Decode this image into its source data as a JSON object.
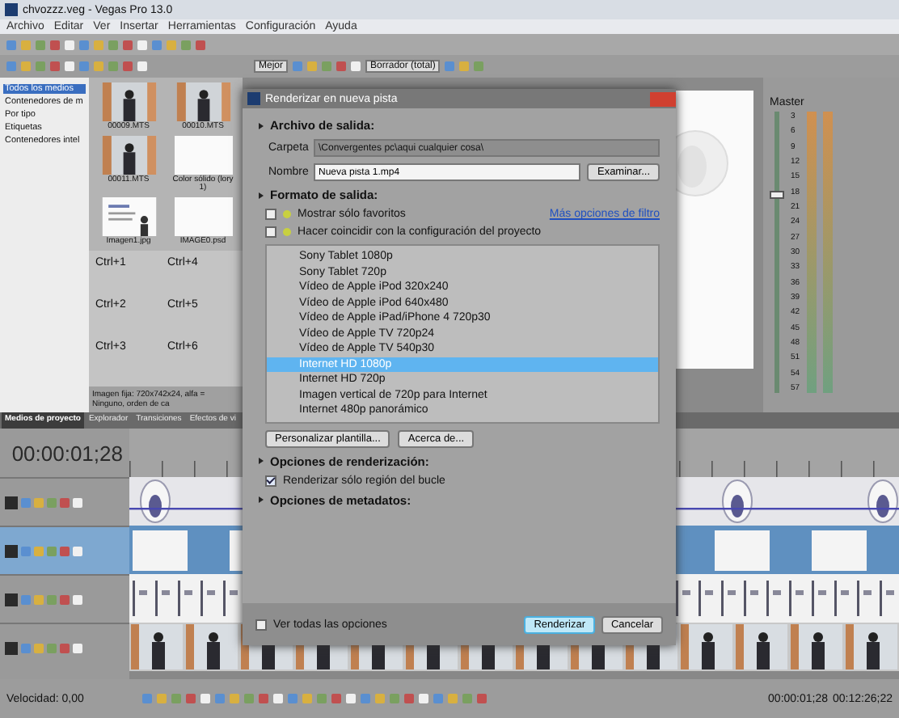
{
  "window": {
    "title": "chvozzz.veg - Vegas Pro 13.0"
  },
  "menu": [
    "Archivo",
    "Editar",
    "Ver",
    "Insertar",
    "Herramientas",
    "Configuración",
    "Ayuda"
  ],
  "toolbar": {
    "zoom_label": "Mejor",
    "format_label": "Borrador (total)"
  },
  "media_tree": [
    {
      "label": "Todos los medios",
      "selected": true
    },
    {
      "label": "Contenedores de m",
      "selected": false
    },
    {
      "label": "Por tipo",
      "selected": false
    },
    {
      "label": "Etiquetas",
      "selected": false
    },
    {
      "label": "Contenedores intel",
      "selected": false
    }
  ],
  "media_items": [
    {
      "name": "00009.MTS",
      "kind": "video"
    },
    {
      "name": "00010.MTS",
      "kind": "video"
    },
    {
      "name": "00011.MTS",
      "kind": "video"
    },
    {
      "name": "Color sólido (lory 1)",
      "kind": "blank"
    },
    {
      "name": "Imagen1.jpg",
      "kind": "slide"
    },
    {
      "name": "IMAGE0.psd",
      "kind": "blank"
    }
  ],
  "shortcuts": [
    "Ctrl+1",
    "Ctrl+4",
    "Ctrl+2",
    "Ctrl+5",
    "Ctrl+3",
    "Ctrl+6"
  ],
  "media_status": "Imagen fija: 720x742x24, alfa = Ninguno, orden de ca",
  "panel_tabs": [
    {
      "label": "Medios de proyecto",
      "selected": true
    },
    {
      "label": "Explorador",
      "selected": false
    },
    {
      "label": "Transiciones",
      "selected": false
    },
    {
      "label": "Efectos de vi",
      "selected": false
    }
  ],
  "meter": {
    "title": "Master",
    "scale": [
      "3",
      "6",
      "9",
      "12",
      "15",
      "18",
      "21",
      "24",
      "27",
      "30",
      "33",
      "36",
      "39",
      "42",
      "45",
      "48",
      "51",
      "54",
      "57"
    ],
    "level": 0.72
  },
  "timeline": {
    "timecode": "00:00:01;28",
    "tracks": [
      {
        "kind": "oval",
        "selected": false
      },
      {
        "kind": "card",
        "selected": true
      },
      {
        "kind": "doc",
        "selected": false
      },
      {
        "kind": "person",
        "selected": false
      }
    ]
  },
  "status_bar": {
    "rate": "Velocidad: 0,00",
    "times": [
      "00:00:01;28",
      "00:12:26;22"
    ]
  },
  "dialog": {
    "title": "Renderizar en nueva pista",
    "output": {
      "header": "Archivo de salida:",
      "folder_label": "Carpeta",
      "folder_value": "\\Convergentes pc\\aqui cualquier cosa\\",
      "name_label": "Nombre",
      "name_value": "Nueva pista 1.mp4",
      "browse": "Examinar..."
    },
    "format": {
      "header": "Formato de salida:",
      "options": [
        {
          "label": "Mostrar sólo favoritos",
          "checked": false
        },
        {
          "label": "Hacer coincidir con la configuración del proyecto",
          "checked": false
        }
      ],
      "link": "Más opciones de filtro",
      "templates": [
        {
          "label": "Sony Tablet 1080p",
          "selected": false
        },
        {
          "label": "Sony Tablet 720p",
          "selected": false
        },
        {
          "label": "Vídeo de Apple iPod 320x240",
          "selected": false
        },
        {
          "label": "Vídeo de Apple iPod 640x480",
          "selected": false
        },
        {
          "label": "Vídeo de Apple iPad/iPhone 4 720p30",
          "selected": false
        },
        {
          "label": "Vídeo de Apple TV 720p24",
          "selected": false
        },
        {
          "label": "Vídeo de Apple TV 540p30",
          "selected": false
        },
        {
          "label": "Internet HD 1080p",
          "selected": true
        },
        {
          "label": "Internet HD 720p",
          "selected": false
        },
        {
          "label": "Imagen vertical de 720p para Internet",
          "selected": false
        },
        {
          "label": "Internet 480p panorámico",
          "selected": false
        }
      ],
      "buttons": [
        "Personalizar plantilla...",
        "Acerca de..."
      ]
    },
    "render": {
      "header": "Opciones de renderización:",
      "option": {
        "label": "Renderizar sólo región del bucle",
        "checked": true
      }
    },
    "metadata": {
      "header": "Opciones de metadatos:"
    },
    "footer": {
      "show_all": {
        "label": "Ver todas las opciones",
        "checked": false
      },
      "buttons": [
        "Renderizar",
        "Cancelar"
      ]
    }
  }
}
